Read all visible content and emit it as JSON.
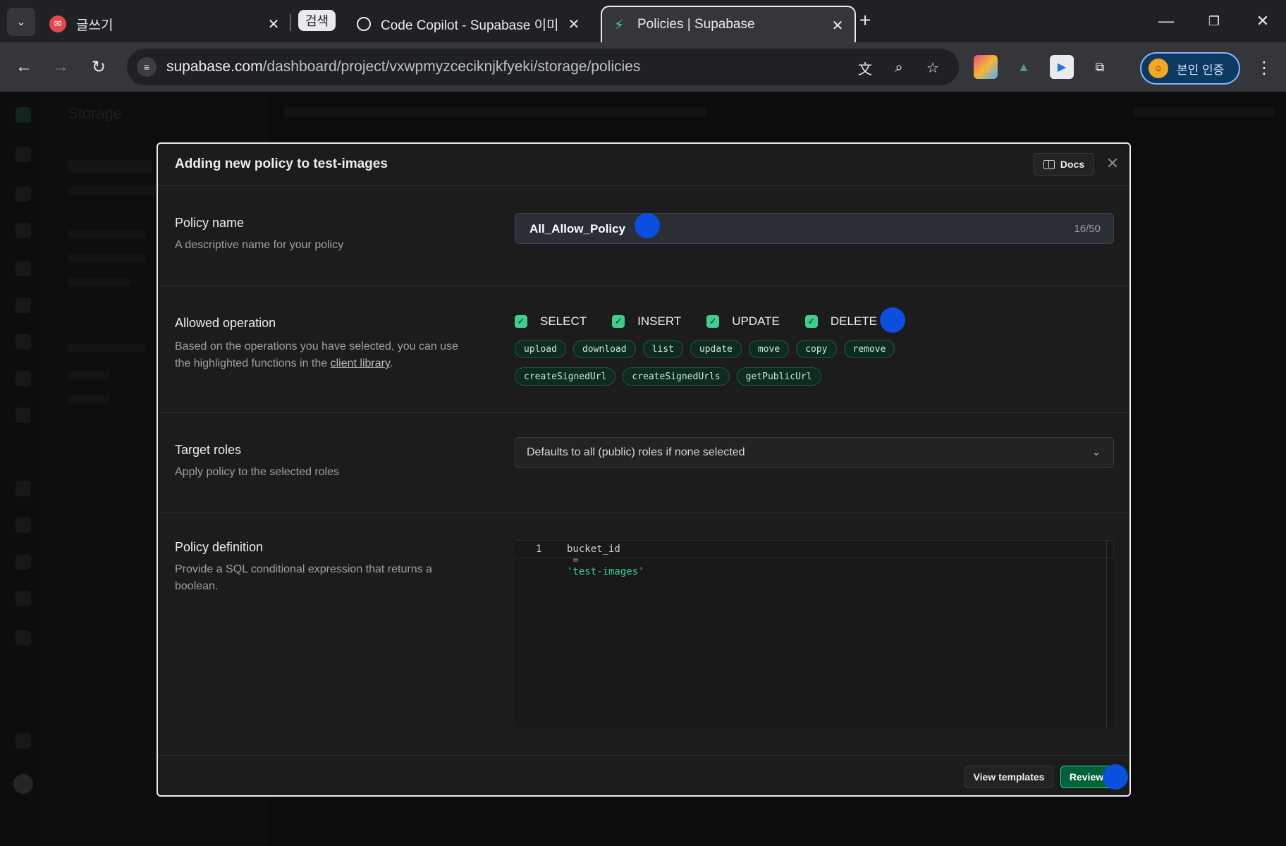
{
  "browser": {
    "tabs": [
      {
        "title": "글쓰기",
        "favicon": "pink-badge-icon"
      },
      {
        "title": "Code Copilot - Supabase 이미",
        "favicon": "openai-icon",
        "group": "검색"
      },
      {
        "title": "Policies | Supabase",
        "favicon": "supabase-bolt-icon",
        "active": true
      }
    ],
    "url_host": "supabase.com",
    "url_path": "/dashboard/project/vxwpmyzceciknjkfyeki/storage/policies",
    "profile_label": "본인 인증"
  },
  "app": {
    "sidebar_title": "Storage"
  },
  "modal": {
    "title": "Adding new policy to test-images",
    "docs_label": "Docs",
    "sections": {
      "policy_name": {
        "title": "Policy name",
        "description": "A descriptive name for your policy",
        "value": "All_Allow_Policy",
        "counter": "16/50"
      },
      "allowed_operation": {
        "title": "Allowed operation",
        "description_before": "Based on the operations you have selected, you can use the highlighted functions in the ",
        "description_link": "client library",
        "description_after": ".",
        "operations": [
          "SELECT",
          "INSERT",
          "UPDATE",
          "DELETE"
        ],
        "functions_row1": [
          "upload",
          "download",
          "list",
          "update",
          "move",
          "copy",
          "remove"
        ],
        "functions_row2": [
          "createSignedUrl",
          "createSignedUrls",
          "getPublicUrl"
        ]
      },
      "target_roles": {
        "title": "Target roles",
        "description": "Apply policy to the selected roles",
        "placeholder": "Defaults to all (public) roles if none selected"
      },
      "policy_definition": {
        "title": "Policy definition",
        "description": "Provide a SQL conditional expression that returns a boolean.",
        "line_number": "1",
        "code_ident": "bucket_id",
        "code_op": " = ",
        "code_string": "'test-images'"
      }
    },
    "footer": {
      "templates_label": "View templates",
      "review_label": "Review"
    }
  },
  "colors": {
    "accent": "#3ecf8e",
    "marker": "#0b4fe0"
  }
}
